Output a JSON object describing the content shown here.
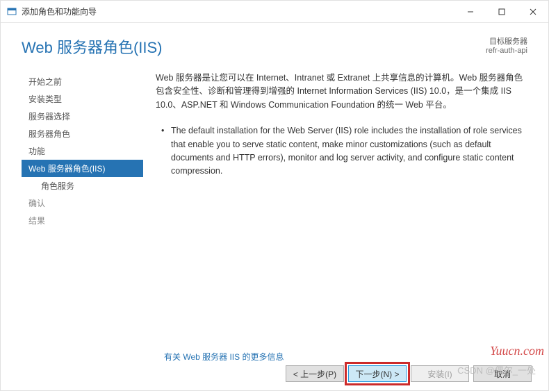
{
  "window": {
    "title": "添加角色和功能向导"
  },
  "header": {
    "page_title": "Web 服务器角色(IIS)",
    "target_label": "目标服务器",
    "target_name": "refr-auth-api"
  },
  "sidebar": {
    "items": [
      {
        "label": "开始之前",
        "state": "enabled"
      },
      {
        "label": "安装类型",
        "state": "enabled"
      },
      {
        "label": "服务器选择",
        "state": "enabled"
      },
      {
        "label": "服务器角色",
        "state": "enabled"
      },
      {
        "label": "功能",
        "state": "enabled"
      },
      {
        "label": "Web 服务器角色(IIS)",
        "state": "active"
      },
      {
        "label": "角色服务",
        "state": "enabled",
        "indent": true
      },
      {
        "label": "确认",
        "state": "disabled"
      },
      {
        "label": "结果",
        "state": "disabled"
      }
    ]
  },
  "content": {
    "intro": "Web 服务器是让您可以在 Internet、Intranet 或 Extranet 上共享信息的计算机。Web 服务器角色包含安全性、诊断和管理得到增强的 Internet Information Services (IIS) 10.0，是一个集成 IIS 10.0、ASP.NET 和 Windows Communication Foundation 的统一 Web 平台。",
    "bullets": [
      "The default installation for the Web Server (IIS) role includes the installation of role services that enable you to serve static content, make minor customizations (such as default documents and HTTP errors), monitor and log server activity, and configure static content compression."
    ],
    "more_link": "有关 Web 服务器 IIS 的更多信息"
  },
  "buttons": {
    "previous": "< 上一步(P)",
    "next": "下一步(N) >",
    "install": "安装(I)",
    "cancel": "取消"
  },
  "watermarks": {
    "w1": "Yuucn.com",
    "w2": "CSDN @偶尔_一处"
  }
}
